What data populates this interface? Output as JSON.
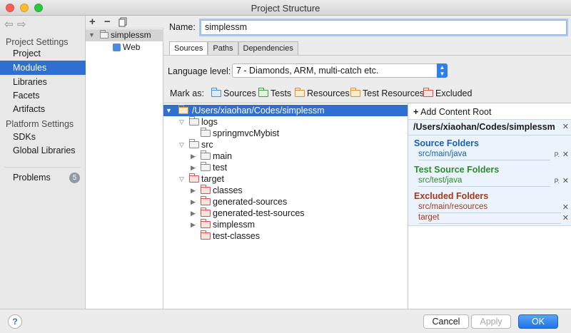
{
  "window": {
    "title": "Project Structure"
  },
  "sidebar": {
    "project_settings_header": "Project Settings",
    "project_items": [
      {
        "label": "Project"
      },
      {
        "label": "Modules"
      },
      {
        "label": "Libraries"
      },
      {
        "label": "Facets"
      },
      {
        "label": "Artifacts"
      }
    ],
    "platform_settings_header": "Platform Settings",
    "platform_items": [
      {
        "label": "SDKs"
      },
      {
        "label": "Global Libraries"
      }
    ],
    "problems": {
      "label": "Problems",
      "count": "5"
    }
  },
  "modules": {
    "items": [
      {
        "label": "simplessm"
      },
      {
        "label": "Web"
      }
    ]
  },
  "module": {
    "name_label": "Name:",
    "name_value": "simplessm",
    "tabs": [
      {
        "label": "Sources"
      },
      {
        "label": "Paths"
      },
      {
        "label": "Dependencies"
      }
    ],
    "language_level_label": "Language level:",
    "language_level_value": "7 - Diamonds, ARM, multi-catch etc.",
    "mark_as_label": "Mark as:",
    "mark_as": [
      {
        "label": "Sources"
      },
      {
        "label": "Tests"
      },
      {
        "label": "Resources"
      },
      {
        "label": "Test Resources"
      },
      {
        "label": "Excluded"
      }
    ]
  },
  "tree": {
    "root": "/Users/xiaohan/Codes/simplessm",
    "logs": "logs",
    "logs_child": "springmvcMybist",
    "src": "src",
    "main": "main",
    "test": "test",
    "target": "target",
    "classes": "classes",
    "generated_sources": "generated-sources",
    "generated_test_sources": "generated-test-sources",
    "simplessm": "simplessm",
    "test_classes": "test-classes"
  },
  "content_roots": {
    "add_label": "Add Content Root",
    "path": "/Users/xiaohan/Codes/simplessm",
    "source_header": "Source Folders",
    "source_value": "src/main/java",
    "test_header": "Test Source Folders",
    "test_value": "src/test/java",
    "excluded_header": "Excluded Folders",
    "excluded_values": [
      "src/main/resources",
      "target"
    ],
    "source_color": "#1c5fb8",
    "test_color": "#2e8b2e",
    "excluded_color": "#a33a1a"
  },
  "footer": {
    "help": "?",
    "cancel": "Cancel",
    "apply": "Apply",
    "ok": "OK",
    "accent": "#1e74e6"
  }
}
